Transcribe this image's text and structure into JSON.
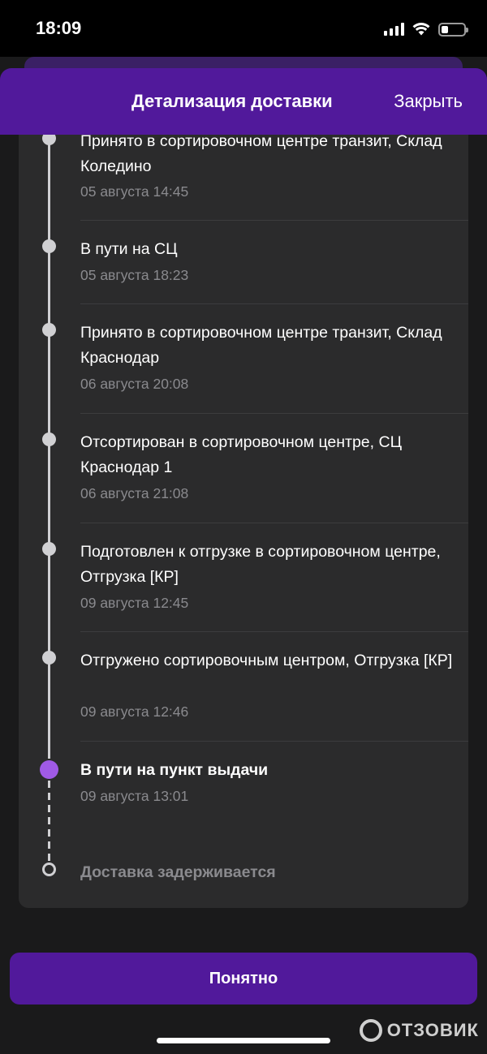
{
  "status_bar": {
    "time": "18:09"
  },
  "header": {
    "title": "Детализация доставки",
    "close_label": "Закрыть"
  },
  "events": [
    {
      "title": "Принято в сортировочном центре транзит, Склад Коледино",
      "date": "05 августа 14:45"
    },
    {
      "title": "В пути на СЦ",
      "date": "05 августа 18:23"
    },
    {
      "title": "Принято в сортировочном центре транзит, Склад Краснодар",
      "date": "06 августа 20:08"
    },
    {
      "title": "Отсортирован в сортировочном центре, СЦ Краснодар 1",
      "date": "06 августа 21:08"
    },
    {
      "title": "Подготовлен к отгрузке в сортировочном центре, Отгрузка [КР]",
      "date": "09 августа 12:45"
    },
    {
      "title": "Отгружено сортировочным центром, Отгрузка [КР]",
      "date": "09 августа 12:46"
    },
    {
      "title": "В пути на пункт выдачи",
      "date": "09 августа 13:01",
      "state": "current"
    },
    {
      "title": "Доставка задерживается",
      "state": "pending"
    }
  ],
  "button": {
    "label": "Понятно"
  },
  "watermark": {
    "text": "ОТЗОВИК"
  },
  "colors": {
    "accent": "#51199b",
    "active_dot": "#a05ae6",
    "card": "#2b2b2c",
    "muted_text": "#8a8a8e"
  },
  "icons": [
    "signal-icon",
    "wifi-icon",
    "battery-icon"
  ]
}
